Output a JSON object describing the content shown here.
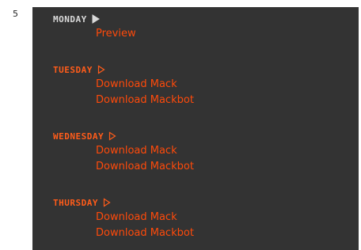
{
  "gutter_number": "5",
  "colors": {
    "panel_background": "#333333",
    "link_color": "#ff4a0a",
    "current_day_heading": "#d9d9d9",
    "other_day_heading": "#ff5c1a"
  },
  "days": [
    {
      "heading": "MONDAY",
      "arrow_icon": "filled-play-arrow-icon",
      "is_current": true,
      "links": [
        "Preview"
      ]
    },
    {
      "heading": "TUESDAY",
      "arrow_icon": "outline-play-arrow-icon",
      "is_current": false,
      "links": [
        "Download Mack",
        "Download Mackbot"
      ]
    },
    {
      "heading": "WEDNESDAY",
      "arrow_icon": "outline-play-arrow-icon",
      "is_current": false,
      "links": [
        "Download Mack",
        "Download Mackbot"
      ]
    },
    {
      "heading": "THURSDAY",
      "arrow_icon": "outline-play-arrow-icon",
      "is_current": false,
      "links": [
        "Download Mack",
        "Download Mackbot"
      ]
    }
  ]
}
